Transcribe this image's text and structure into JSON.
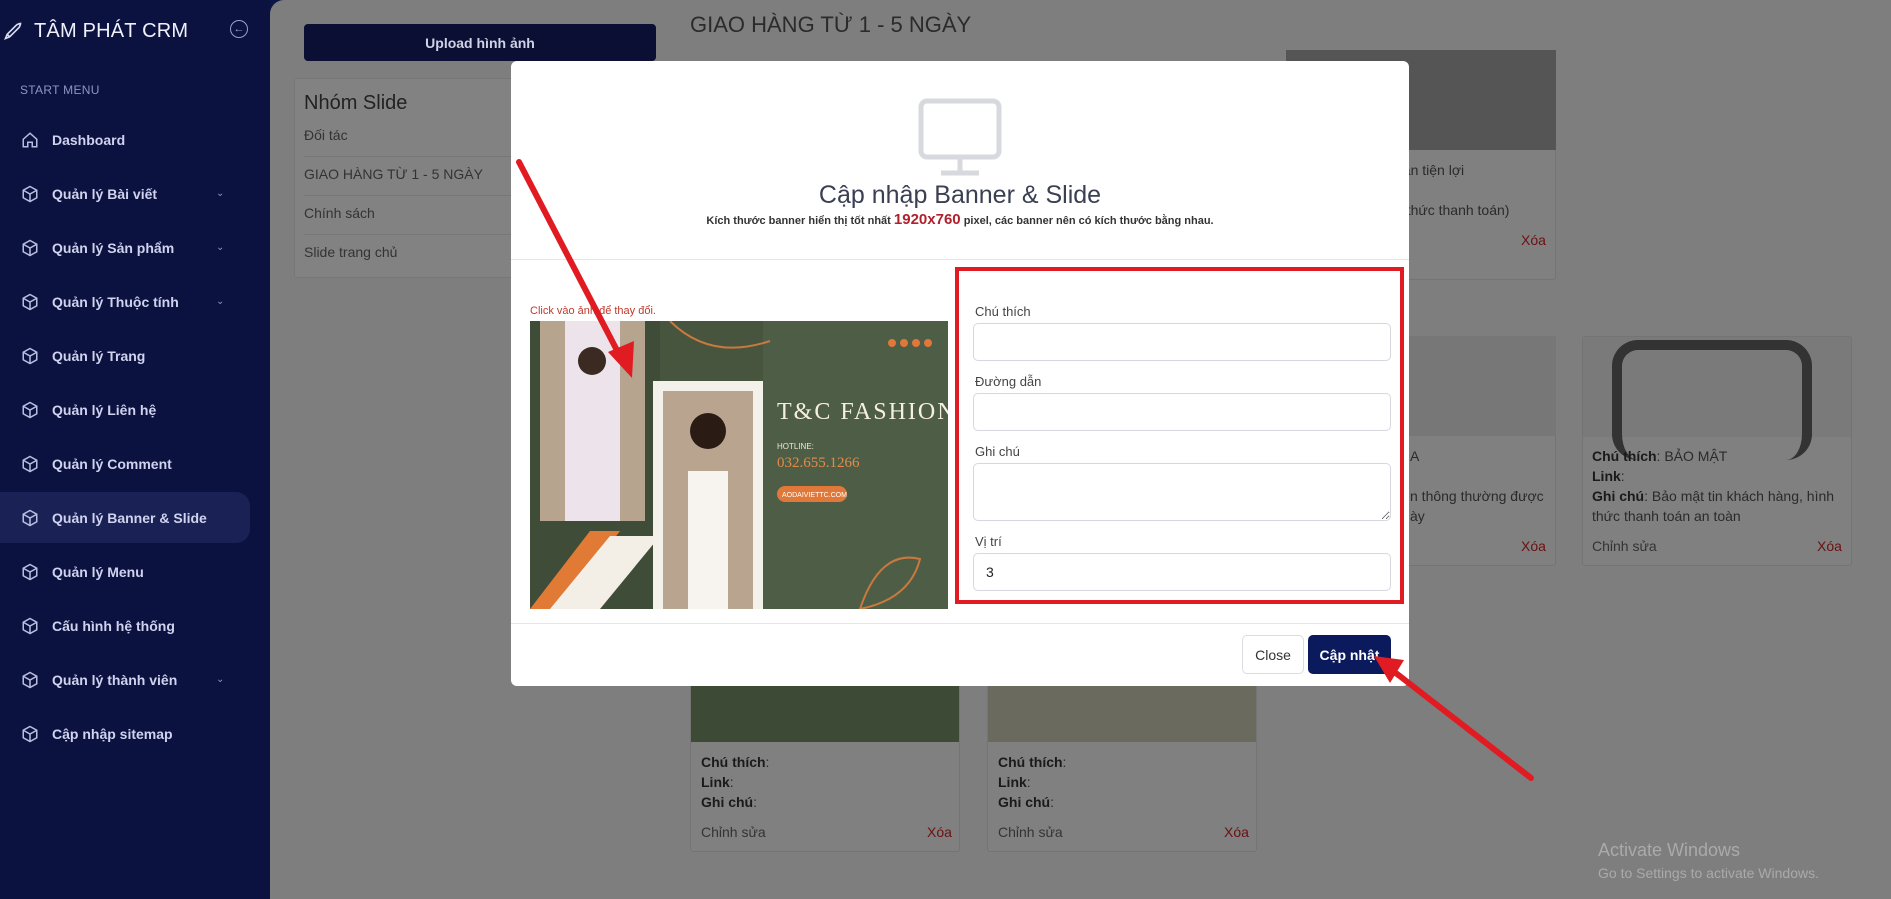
{
  "sidebar": {
    "brand": "TÂM PHÁT CRM",
    "heading": "START MENU",
    "items": [
      {
        "label": "Dashboard",
        "icon": "home-icon",
        "chevron": false
      },
      {
        "label": "Quản lý Bài viết",
        "icon": "cube-icon",
        "chevron": true
      },
      {
        "label": "Quản lý Sản phẩm",
        "icon": "cube-icon",
        "chevron": true
      },
      {
        "label": "Quản lý Thuộc tính",
        "icon": "cube-icon",
        "chevron": true
      },
      {
        "label": "Quản lý Trang",
        "icon": "cube-icon",
        "chevron": false
      },
      {
        "label": "Quản lý Liên hệ",
        "icon": "cube-icon",
        "chevron": false
      },
      {
        "label": "Quản lý Comment",
        "icon": "cube-icon",
        "chevron": false
      },
      {
        "label": "Quản lý Banner & Slide",
        "icon": "cube-icon",
        "chevron": false,
        "active": true
      },
      {
        "label": "Quản lý Menu",
        "icon": "cube-icon",
        "chevron": false
      },
      {
        "label": "Cấu hình hệ thống",
        "icon": "cube-icon",
        "chevron": false
      },
      {
        "label": "Quản lý thành viên",
        "icon": "cube-icon",
        "chevron": true
      },
      {
        "label": "Cập nhập sitemap",
        "icon": "cube-icon",
        "chevron": false
      }
    ]
  },
  "main": {
    "upload_label": "Upload hình ảnh",
    "group_title": "Nhóm Slide",
    "groups": [
      "Đối tác",
      "GIAO HÀNG TỪ 1 - 5 NGÀY",
      "Chính sách",
      "Slide trang chủ"
    ],
    "section_title": "GIAO HÀNG TỪ 1 - 5 NGÀY",
    "card_top": {
      "text1": "oán tiện lợi",
      "text2": "h thức thanh toán)",
      "delete": "Xóa"
    },
    "card_mid": {
      "text1": "A",
      "text2": "n thông thường được",
      "text3": "ày",
      "delete": "Xóa"
    },
    "card_right": {
      "caption_label": "Chú thích",
      "caption_value": ": BẢO MẬT",
      "link_label": "Link",
      "link_value": ":",
      "note_label": "Ghi chú",
      "note_value": ": Bảo mật tin khách hàng, hình thức thanh toán an toàn",
      "edit": "Chỉnh sửa",
      "delete": "Xóa"
    },
    "cards_bottom": [
      {
        "caption_label": "Chú thích",
        "link_label": "Link",
        "note_label": "Ghi chú",
        "colon": ":",
        "edit": "Chỉnh sửa",
        "delete": "Xóa"
      },
      {
        "caption_label": "Chú thích",
        "link_label": "Link",
        "note_label": "Ghi chú",
        "colon": ":",
        "edit": "Chỉnh sửa",
        "delete": "Xóa"
      }
    ]
  },
  "modal": {
    "title": "Cập nhập Banner & Slide",
    "subtitle_before": "Kích thước banner hiển thị tốt nhất ",
    "subtitle_size": "1920x760",
    "subtitle_after": " pixel, các banner nên có kích thước bằng nhau.",
    "hint": "Click vào ảnh để thay đổi.",
    "banner": {
      "brand": "T&C FASHION",
      "hotline_label": "HOTLINE:",
      "hotline": "032.655.1266",
      "website": "AODAIVIETTC.COM"
    },
    "fields": {
      "caption_label": "Chú thích",
      "caption_value": "",
      "link_label": "Đường dẫn",
      "link_value": "",
      "note_label": "Ghi chú",
      "note_value": "",
      "position_label": "Vị trí",
      "position_value": "3"
    },
    "close_label": "Close",
    "update_label": "Cập nhật"
  },
  "watermark": {
    "line1": "Activate Windows",
    "line2": "Go to Settings to activate Windows."
  },
  "colors": {
    "sidebar_bg": "#0b1240",
    "accent": "#0b1a5c",
    "annotation_red": "#e11b22",
    "delete_red": "#c0392b"
  }
}
